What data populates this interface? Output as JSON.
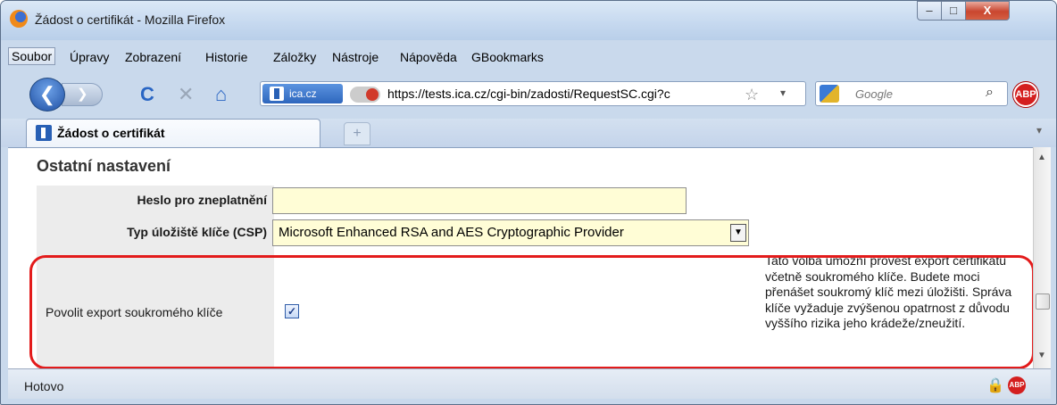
{
  "window": {
    "title": "Žádost o certifikát - Mozilla Firefox",
    "min_label": "–",
    "max_label": "□",
    "close_label": "X"
  },
  "menu": [
    "Soubor",
    "Úpravy",
    "Zobrazení",
    "Historie",
    "Záložky",
    "Nástroje",
    "Nápověda",
    "GBookmarks"
  ],
  "nav": {
    "back": "❮",
    "forward": "❯",
    "reload": "C",
    "stop": "✕",
    "home": "⌂"
  },
  "urlbar": {
    "site_label": "ica.cz",
    "url": "https://tests.ica.cz/cgi-bin/zadosti/RequestSC.cgi?c",
    "star": "☆",
    "dropdown": "▾"
  },
  "search": {
    "placeholder": "Google",
    "icon": "⌕"
  },
  "addons": {
    "abp_label": "ABP"
  },
  "tab": {
    "title": "Žádost o certifikát",
    "new_tab": "+",
    "list": "▾"
  },
  "form": {
    "section_title": "Ostatní nastavení",
    "revoke_password_label": "Heslo pro zneplatnění",
    "revoke_password_value": "",
    "csp_label": "Typ úložiště klíče (CSP)",
    "csp_value": "Microsoft Enhanced RSA and AES Cryptographic Provider",
    "export_label": "Povolit export soukromého klíče",
    "export_checked": true,
    "export_check_glyph": "✓",
    "export_description": "Tato volba umožní provést export certifikátu včetně soukromého klíče. Budete moci přenášet soukromý klíč mezi úložišti. Správa klíče vyžaduje zvýšenou opatrnost z důvodu vyššího rizika jeho krádeže/zneužití."
  },
  "scrollbar": {
    "up": "▲",
    "down": "▼"
  },
  "status": {
    "text": "Hotovo",
    "lock_icon": "🔒",
    "abp_label": "ABP"
  },
  "colors": {
    "highlight": "#e31b1b",
    "input_bg": "#fffdd6",
    "label_bg": "#ececec"
  }
}
